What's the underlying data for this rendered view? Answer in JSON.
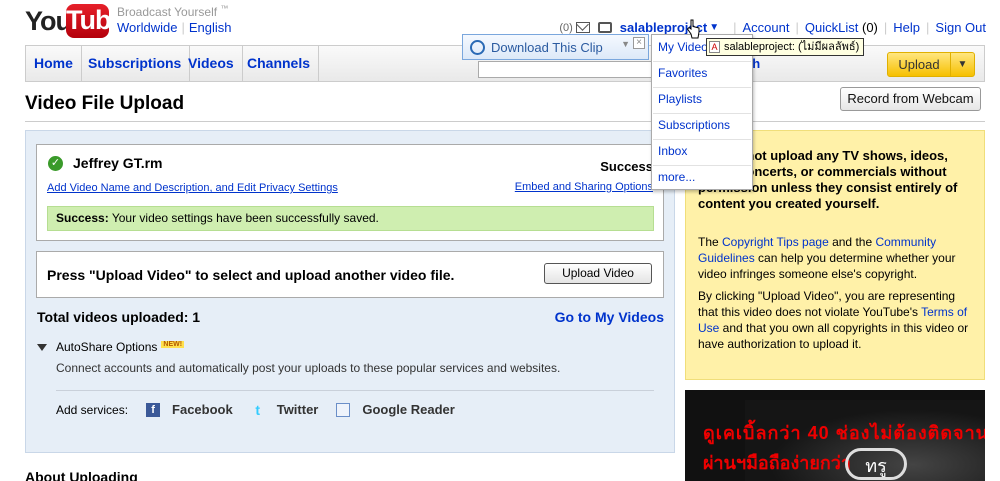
{
  "header": {
    "logo_you": "You",
    "logo_tube": "Tube",
    "tagline": "Broadcast Yourself",
    "tagline_tm": "™",
    "locale_country": "Worldwide",
    "locale_language": "English",
    "inbox_count": "(0)",
    "username": "salableproject",
    "account": "Account",
    "quicklist": "QuickList",
    "quicklist_count": "(0)",
    "help": "Help",
    "signout": "Sign Out"
  },
  "nav": {
    "tabs": [
      "Home",
      "Subscriptions",
      "Videos",
      "Channels"
    ],
    "search_button": "rch",
    "upload": "Upload"
  },
  "download_clip": {
    "label": "Download This Clip"
  },
  "dropdown": {
    "items": [
      "My Videos",
      "Favorites",
      "Playlists",
      "Subscriptions",
      "Inbox",
      "more..."
    ]
  },
  "tooltip": {
    "text": "salableproject: (ไม่มีผลลัพธ์)"
  },
  "page": {
    "title": "Video File Upload",
    "webcam_button": "Record from Webcam"
  },
  "file": {
    "name": "Jeffrey GT.rm",
    "status": "Success",
    "edit_link": "Add Video Name and Description, and Edit Privacy Settings",
    "embed_link": "Embed and Sharing Options",
    "success_label": "Success:",
    "success_msg": " Your video settings have been successfully saved."
  },
  "upload_again": {
    "prompt": "Press \"Upload Video\" to select and upload another video file.",
    "button": "Upload Video"
  },
  "totals": {
    "label": "Total videos uploaded: 1",
    "go_link": "Go to My Videos"
  },
  "autoshare": {
    "title": "AutoShare Options",
    "badge": "NEW!",
    "description": "Connect accounts and automatically post your uploads to these popular services and websites.",
    "add_label": "Add services:",
    "services": [
      "Facebook",
      "Twitter",
      "Google Reader"
    ]
  },
  "about": "About Uploading",
  "warning": {
    "bold_text": "ant: Do not upload any TV shows, ideos, music concerts, or commercials without permission unless they consist entirely of content you created yourself.",
    "p2_pre": "The ",
    "p2_link1": "Copyright Tips page",
    "p2_mid": " and the ",
    "p2_link2": "Community Guidelines",
    "p2_post": " can help you determine whether your video infringes someone else's copyright.",
    "p3_pre": "By clicking \"Upload Video\", you are representing that this video does not violate YouTube's ",
    "p3_link": "Terms of Use",
    "p3_post": " and that you own all copyrights in this video or have authorization to upload it."
  },
  "ad": {
    "line1": "ดูเคเบิ้ลกว่า 40 ช่องไม่ต้องติดจาน",
    "line2": "ผ่านฯมือถือง่ายกว่า",
    "badge": "ทรู"
  },
  "colors": {
    "link": "#0033cc",
    "success_bg": "#cfeeb0",
    "warning_bg": "#fff1a8",
    "upload_button": "#f6c000",
    "panel_bg": "#e6eef7"
  }
}
